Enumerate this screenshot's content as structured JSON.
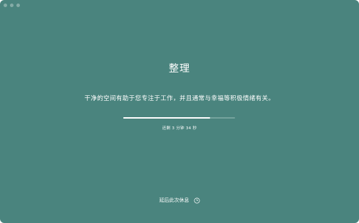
{
  "window": {
    "background_color": "#4a847e",
    "traffic_lights": [
      "close",
      "minimize",
      "zoom"
    ]
  },
  "break": {
    "title": "整理",
    "message": "干净的空间有助于您专注于工作，并且通常与幸福等积极情绪有关。",
    "progress_fraction": 0.78,
    "remaining_text": "还剩 3 分钟 34 秒"
  },
  "actions": {
    "snooze_label": "延后此次休息",
    "snooze_icon": "clock-icon"
  }
}
